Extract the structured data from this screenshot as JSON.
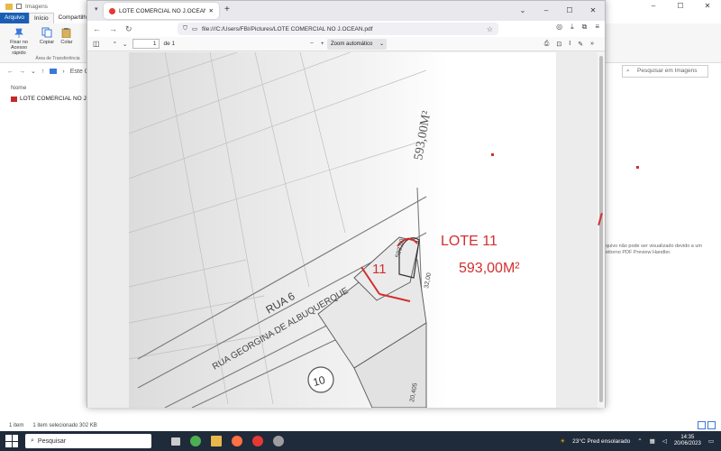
{
  "explorer": {
    "title": "Imagens",
    "ribbon_tabs": [
      "Arquivo",
      "Início",
      "Compartilhar"
    ],
    "ribbon_buttons": {
      "pin": "Fixar no Acesso rápido",
      "copy": "Copiar",
      "paste": "Colar",
      "group_label": "Área de Transferência"
    },
    "address": "Este Comp",
    "search_placeholder": "Pesquisar em Imagens",
    "column_name": "Nome",
    "file_name": "LOTE COMERCIAL NO J.OCEAN",
    "preview_message": "quivo não pode ser visualizado devido a um eitorno PDF Preview Handler.",
    "status_count": "1 item",
    "status_selected": "1 item selecionado  302 KB"
  },
  "firefox": {
    "tab_title": "LOTE COMERCIAL NO J.OCEAN.pdf",
    "url": "file:///C:/Users/FBI/Pictures/LOTE COMERCIAL NO J.OCEAN.pdf",
    "page_current": "1",
    "page_total": "de 1",
    "zoom": "Zoom automático"
  },
  "pdf": {
    "lot_label": "LOTE 11",
    "lot_area": "593,00M²",
    "lot_number": "11",
    "block_number": "10",
    "street_1": "RUA 6",
    "street_2": "RUA GEORGINA DE ALBUQUERQUE",
    "handwritten_area": "593,00M²",
    "handwritten_num": "593,00",
    "dim_1": "32,00",
    "dim_2": "20,405"
  },
  "taskbar": {
    "search": "Pesquisar",
    "weather": "23°C  Pred ensolarado",
    "time": "14:35",
    "date": "20/06/2023"
  },
  "colors": {
    "accent": "#1a5fb4",
    "annotation_red": "#d32f2f",
    "taskbar": "#1f2a3a"
  }
}
